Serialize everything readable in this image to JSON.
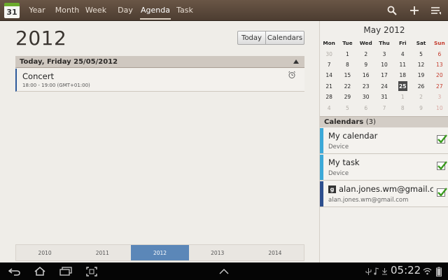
{
  "app": {
    "icon_day": "31",
    "icon_name": "calendar-app-icon"
  },
  "tabs": [
    {
      "label": "Year",
      "active": false
    },
    {
      "label": "Month",
      "active": false
    },
    {
      "label": "Week",
      "active": false
    },
    {
      "label": "Day",
      "active": false
    },
    {
      "label": "Agenda",
      "active": true
    },
    {
      "label": "Task",
      "active": false
    }
  ],
  "toolbar_icons": [
    "search-icon",
    "add-icon",
    "menu-icon"
  ],
  "main": {
    "year_title": "2012",
    "today_button": "Today",
    "calendars_button": "Calendars",
    "day_header": "Today, Friday 25/05/2012",
    "events": [
      {
        "title": "Concert",
        "time": "18:00 - 19:00 (GMT+01:00)",
        "color": "#2d5a9b"
      }
    ],
    "years": [
      {
        "label": "2010",
        "selected": false
      },
      {
        "label": "2011",
        "selected": false
      },
      {
        "label": "2012",
        "selected": true
      },
      {
        "label": "2013",
        "selected": false
      },
      {
        "label": "2014",
        "selected": false
      }
    ]
  },
  "mini_calendar": {
    "month": "May 2012",
    "weekdays": [
      "Mon",
      "Tue",
      "Wed",
      "Thu",
      "Fri",
      "Sat",
      "Sun"
    ],
    "weeks": [
      [
        "30",
        "1",
        "2",
        "3",
        "4",
        "5",
        "6"
      ],
      [
        "7",
        "8",
        "9",
        "10",
        "11",
        "12",
        "13"
      ],
      [
        "14",
        "15",
        "16",
        "17",
        "18",
        "19",
        "20"
      ],
      [
        "21",
        "22",
        "23",
        "24",
        "25",
        "26",
        "27"
      ],
      [
        "28",
        "29",
        "30",
        "31",
        "1",
        "2",
        "3"
      ],
      [
        "4",
        "5",
        "6",
        "7",
        "8",
        "9",
        "10"
      ]
    ],
    "selected_day": "25"
  },
  "calendars": {
    "header": "Calendars",
    "count": "(3)",
    "items": [
      {
        "name": "My calendar",
        "sub": "Device",
        "color": "#3ca9d8",
        "checked": true,
        "google": false
      },
      {
        "name": "My task",
        "sub": "Device",
        "color": "#3ca9d8",
        "checked": true,
        "google": false
      },
      {
        "name": "alan.jones.wm@gmail.c...",
        "sub": "alan.jones.wm@gmail.com",
        "color": "#2d4f8e",
        "checked": true,
        "google": true,
        "google_letter": "g"
      }
    ]
  },
  "status": {
    "time": "05:22"
  },
  "colors": {
    "accent": "#5b87b8",
    "sunday": "#c43a2c",
    "check": "#3a9a1e"
  }
}
